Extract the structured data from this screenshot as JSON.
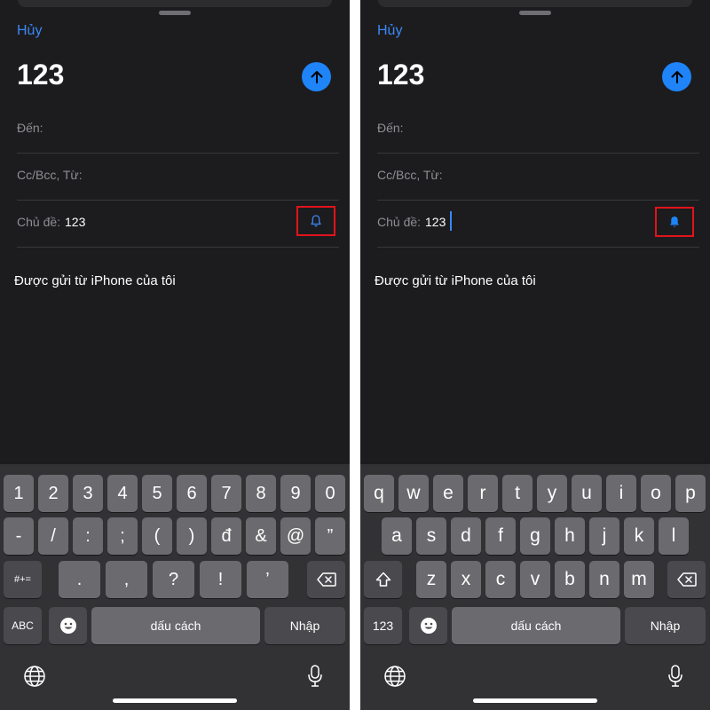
{
  "compose": {
    "cancel_label": "Hủy",
    "title": "123",
    "to_label": "Đến:",
    "cc_label": "Cc/Bcc, Từ:",
    "subject_label": "Chủ đề:",
    "subject_value": "123",
    "signature": "Được gửi từ iPhone của tôi"
  },
  "keyboard": {
    "space_label": "dấu cách",
    "return_label": "Nhập",
    "symbols_toggle": "#+=",
    "abc_toggle": "ABC",
    "numbers_toggle": "123",
    "numbers_row1": [
      "1",
      "2",
      "3",
      "4",
      "5",
      "6",
      "7",
      "8",
      "9",
      "0"
    ],
    "numbers_row2": [
      "-",
      "/",
      ":",
      ";",
      "(",
      ")",
      "đ",
      "&",
      "@",
      "”"
    ],
    "numbers_row3": [
      ".",
      ",",
      "?",
      "!",
      "’"
    ],
    "letters_row1": [
      "q",
      "w",
      "e",
      "r",
      "t",
      "y",
      "u",
      "i",
      "o",
      "p"
    ],
    "letters_row2": [
      "a",
      "s",
      "d",
      "f",
      "g",
      "h",
      "j",
      "k",
      "l"
    ],
    "letters_row3": [
      "z",
      "x",
      "c",
      "v",
      "b",
      "n",
      "m"
    ]
  },
  "icons": {
    "send": "arrow-up-icon",
    "notify_left": "bell-outline-icon",
    "notify_right": "bell-filled-icon",
    "shift": "shift-icon",
    "delete": "backspace-icon",
    "emoji": "emoji-icon",
    "globe": "globe-icon",
    "mic": "microphone-icon"
  },
  "colors": {
    "accent": "#1e84f7",
    "highlight_box": "#e3131b",
    "background": "#1c1c1e"
  }
}
